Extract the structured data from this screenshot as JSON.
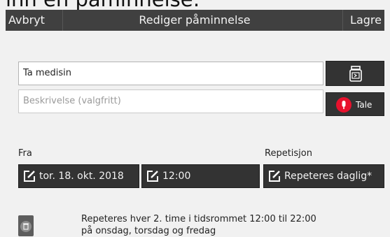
{
  "overlay_caption": "ınn en påminnelse:",
  "header": {
    "cancel_label": "Avbryt",
    "title": "Rediger påminnelse",
    "save_label": "Lagre"
  },
  "form": {
    "title_value": "Ta medisin",
    "description_placeholder": "Beskrivelse (valgfritt)",
    "speech_button_label": "Tale",
    "image_button_icon": "medicine-jar-icon"
  },
  "schedule": {
    "from_label": "Fra",
    "repeat_label": "Repetisjon",
    "date_value": "tor. 18. okt. 2018",
    "time_value": "12:00",
    "repeat_value": "Repeteres daglig*"
  },
  "summary": {
    "line1": "Repeteres hver 2. time i tidsrommet 12:00 til 22:00",
    "line2": "på onsdag, torsdag og fredag"
  },
  "colors": {
    "header_bg": "#404040",
    "page_bg": "#f1f1f1",
    "button_bg": "#333333",
    "mic_red": "#e8112d"
  }
}
